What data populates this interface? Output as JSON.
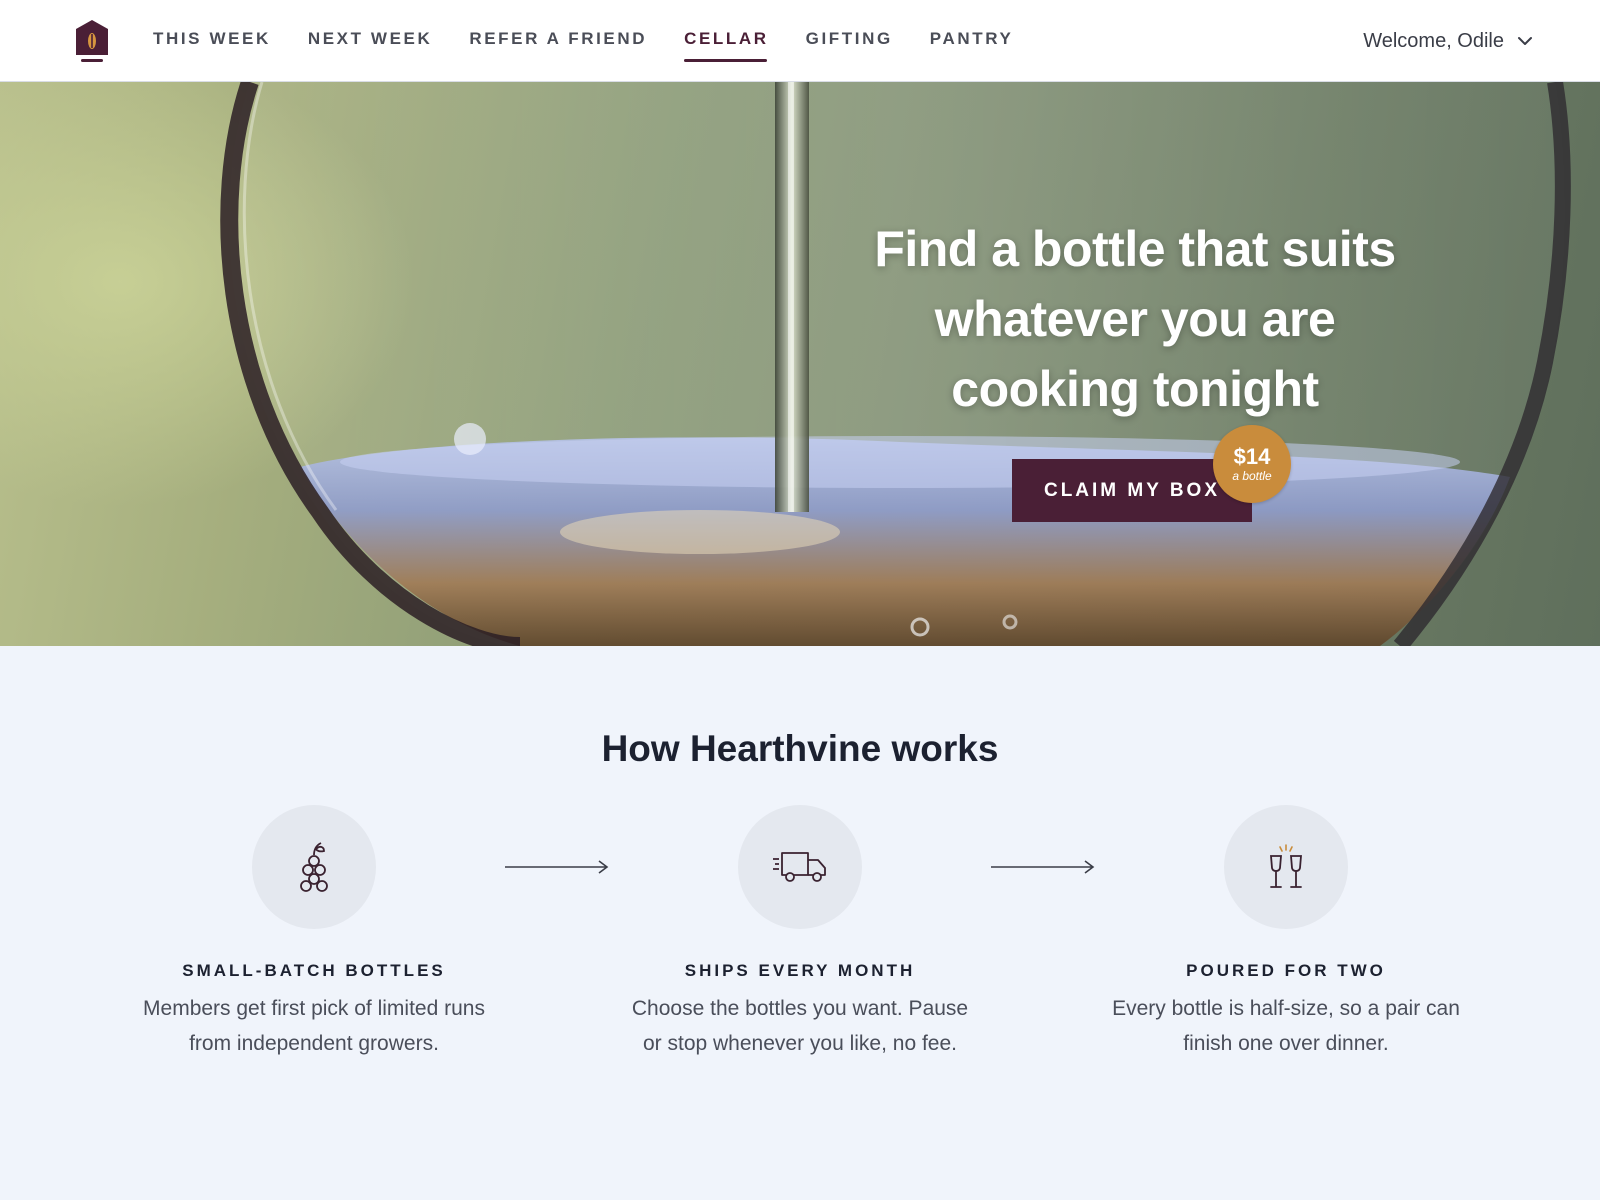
{
  "header": {
    "logo_icon": "hearthvine-house-logo",
    "nav": [
      {
        "label": "THIS WEEK",
        "active": false
      },
      {
        "label": "NEXT WEEK",
        "active": false
      },
      {
        "label": "REFER A FRIEND",
        "active": false
      },
      {
        "label": "CELLAR",
        "active": true
      },
      {
        "label": "GIFTING",
        "active": false
      },
      {
        "label": "PANTRY",
        "active": false
      }
    ],
    "welcome": "Welcome, Odile",
    "welcome_icon": "chevron-down-icon"
  },
  "hero": {
    "title_lines": [
      "Find a bottle that suits",
      "whatever you are",
      "cooking tonight"
    ],
    "cta_label": "CLAIM MY BOX",
    "badge_price": "$14",
    "badge_sub": "a bottle"
  },
  "how": {
    "title": "How Hearthvine works",
    "steps": [
      {
        "icon": "grapes-icon",
        "title": "SMALL-BATCH BOTTLES",
        "text": "Members get first pick of limited runs from independent growers."
      },
      {
        "icon": "delivery-truck-icon",
        "title": "SHIPS EVERY MONTH",
        "text": "Choose the bottles you want. Pause or stop whenever you like, no fee."
      },
      {
        "icon": "wine-glasses-cheers-icon",
        "title": "POURED FOR TWO",
        "text": "Every bottle is half-size, so a pair can finish one over dinner."
      }
    ]
  },
  "colors": {
    "brand_plum": "#4a1f36",
    "badge_amber": "#c98c3c",
    "section_bg": "#f0f4fb"
  }
}
